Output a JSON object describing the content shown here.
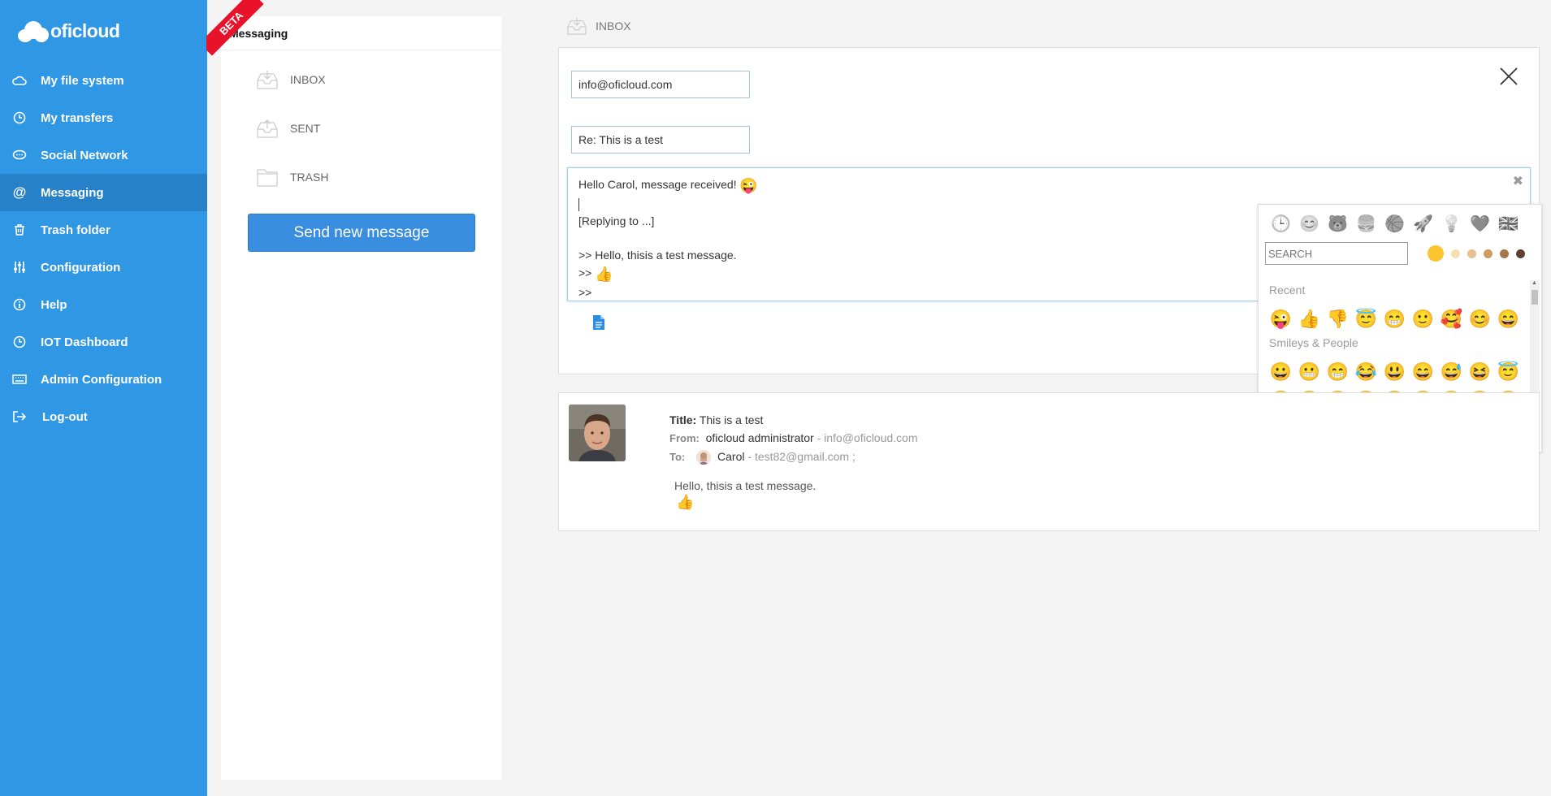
{
  "app": {
    "logo_text": "oficloud"
  },
  "sidebar": {
    "items": [
      {
        "label": "My file system",
        "icon": "cloud-icon"
      },
      {
        "label": "My transfers",
        "icon": "clock-icon"
      },
      {
        "label": "Social Network",
        "icon": "chat-icon"
      },
      {
        "label": "Messaging",
        "icon": "at-icon",
        "active": true
      },
      {
        "label": "Trash folder",
        "icon": "trash-icon"
      },
      {
        "label": "Configuration",
        "icon": "sliders-icon"
      },
      {
        "label": "Help",
        "icon": "info-icon"
      },
      {
        "label": "IOT Dashboard",
        "icon": "clock-icon"
      },
      {
        "label": "Admin Configuration",
        "icon": "keyboard-icon"
      },
      {
        "label": "Log-out",
        "icon": "logout-icon"
      }
    ]
  },
  "folders": {
    "header": "Messaging",
    "beta_label": "BETA",
    "items": [
      {
        "label": "INBOX",
        "icon": "inbox-icon"
      },
      {
        "label": "SENT",
        "icon": "sent-icon"
      },
      {
        "label": "TRASH",
        "icon": "folder-icon"
      }
    ],
    "send_button": "Send new message"
  },
  "main": {
    "breadcrumb": "INBOX",
    "compose": {
      "to_value": "info@oficloud.com",
      "subject_value": "Re: This is a test",
      "editor_lines": {
        "line1": "Hello Carol, message received!",
        "line3": "[Replying to ...]",
        "line5": ">> Hello, thisis a test message.",
        "line6": ">>",
        "line7": ">>"
      },
      "editor_close": "✖"
    },
    "emoji_picker": {
      "categories": [
        "🕒",
        "😊",
        "🐻",
        "🍔",
        "🏀",
        "🚀",
        "💡",
        "💜",
        "🇬🇧"
      ],
      "search_placeholder": "SEARCH",
      "tones": [
        "#fbc531",
        "#f7dfb4",
        "#e7c28f",
        "#d09b63",
        "#a87548",
        "#5b4033"
      ],
      "sections": {
        "recent_title": "Recent",
        "recent": [
          "😜",
          "👍",
          "👎",
          "😇",
          "😁",
          "🙂",
          "🥰",
          "😊",
          "😄"
        ],
        "smileys_title": "Smileys & People",
        "smileys_row1": [
          "😀",
          "😬",
          "😁",
          "😂",
          "😃",
          "😄",
          "😅",
          "😆",
          "😇"
        ],
        "smileys_row2": [
          "😉",
          "😊",
          "🙂",
          "🙃",
          "☺️",
          "😋",
          "😌",
          "😍",
          "😘"
        ],
        "smileys_row3": [
          "😗",
          "😙",
          "😚",
          "😜",
          "😝",
          "😛",
          "🤑",
          "🤓",
          "😎"
        ]
      }
    },
    "message": {
      "title_label": "Title:",
      "title_value": "This is a test",
      "from_label": "From:",
      "from_name": "oficloud administrator",
      "from_email": "- info@oficloud.com",
      "to_label": "To:",
      "to_name": "Carol",
      "to_email": "- test82@gmail.com ;",
      "body_line1": "Hello, thisis a test message."
    }
  }
}
